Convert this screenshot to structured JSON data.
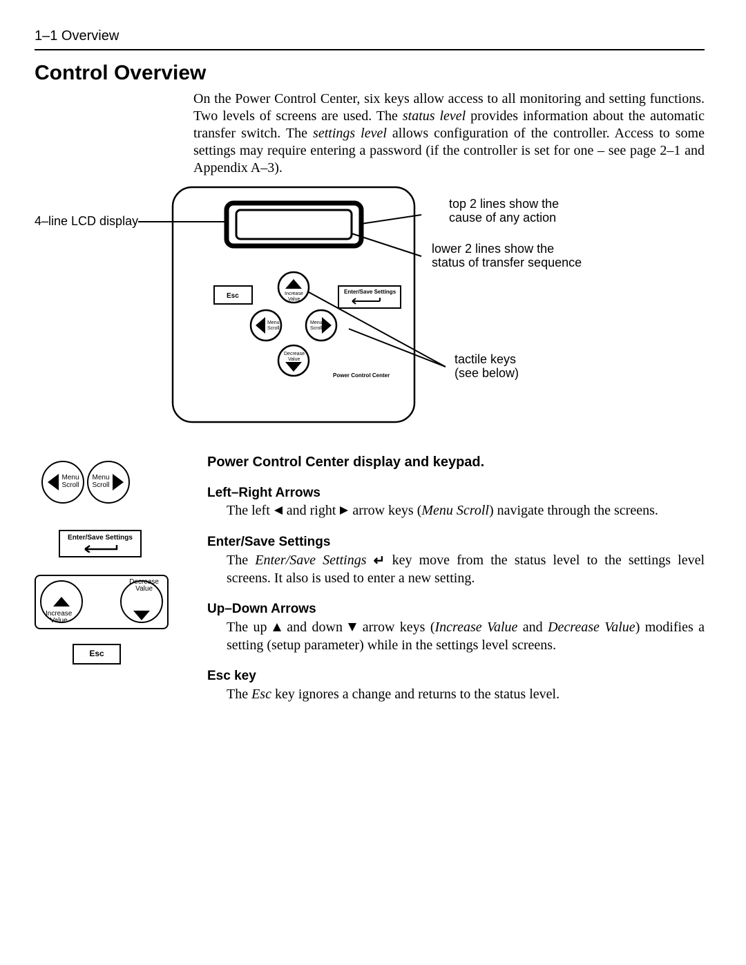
{
  "header": {
    "breadcrumb": "1–1  Overview"
  },
  "title": "Control Overview",
  "intro": {
    "t1": "On the Power Control Center, six keys allow access to all monitoring and setting functions. Two levels of screens are used. The ",
    "i1": "status level",
    "t2": " provides information about the automatic transfer switch. The ",
    "i2": "settings level",
    "t3": " allows configuration of the controller. Access to some settings may require entering a password (if the controller is set for one – see page 2–1 and Appendix A–3)."
  },
  "diagram": {
    "lcd_label": "4–line LCD display",
    "top_note_a": "top 2 lines show the",
    "top_note_b": "cause of any action",
    "bot_note_a": "lower 2 lines show the",
    "bot_note_b": "status of transfer sequence",
    "tactile_a": "tactile  keys",
    "tactile_b": "(see below)",
    "esc": "Esc",
    "enter": "Enter/Save Settings",
    "increase_a": "Increase",
    "increase_b": "Value",
    "decrease_a": "Decrease",
    "decrease_b": "Value",
    "menu_a": "Menu",
    "menu_b": "Scroll",
    "pcc": "Power Control Center"
  },
  "caption": "Power Control Center display and keypad.",
  "sections": {
    "lr": {
      "head": "Left–Right Arrows",
      "p_a": "The left ",
      "p_b": " and right ",
      "p_c": " arrow keys (",
      "i": "Menu Scroll",
      "p_d": ") navigate through the screens."
    },
    "enter": {
      "head": "Enter/Save Settings",
      "p_a": "The ",
      "i": "Enter/Save Settings",
      "p_b": " key move from the status level to the settings level screens.  It also is used to enter a new setting."
    },
    "ud": {
      "head": "Up–Down Arrows",
      "p_a": "The up ",
      "p_b": " and down ",
      "p_c": " arrow keys (",
      "i1": "Increase Value",
      "and": " and ",
      "i2": "Decrease Value",
      "p_d": ") modifies a setting (setup parameter) while in the settings level screens."
    },
    "esc": {
      "head": "Esc key",
      "p_a": "The ",
      "i": "Esc",
      "p_b": " key ignores a change and returns to the status level."
    }
  },
  "leftkeys": {
    "menu_a": "Menu",
    "menu_b": "Scroll",
    "enter": "Enter/Save Settings",
    "increase_a": "Increase",
    "increase_b": "Value",
    "decrease_a": "Decrease",
    "decrease_b": "Value",
    "esc": "Esc"
  }
}
